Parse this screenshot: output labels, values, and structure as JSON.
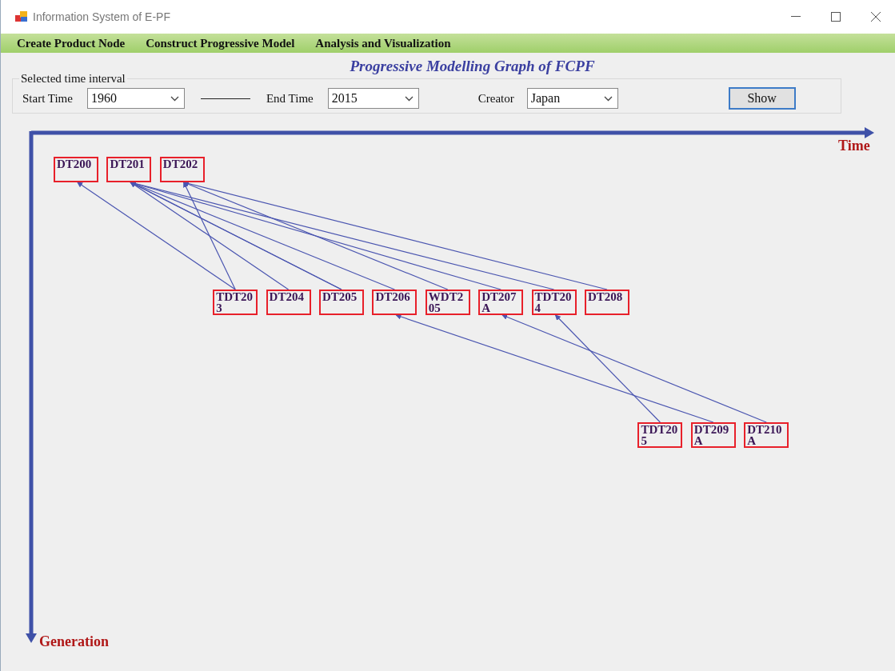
{
  "window": {
    "title": "Information System of E-PF"
  },
  "menu": [
    "Create Product Node",
    "Construct Progressive Model",
    "Analysis and Visualization"
  ],
  "heading": "Progressive Modelling Graph of FCPF",
  "filter": {
    "legend": "Selected time interval",
    "start_label": "Start Time",
    "start_value": "1960",
    "end_label": "End Time",
    "end_value": "2015",
    "creator_label": "Creator",
    "creator_value": "Japan",
    "button": "Show"
  },
  "graph": {
    "x_axis": "Time",
    "y_axis": "Generation",
    "generations": [
      {
        "nodes": [
          "DT200",
          "DT201",
          "DT202"
        ]
      },
      {
        "nodes": [
          "TDT203",
          "DT204",
          "DT205",
          "DT206",
          "WDT205",
          "DT207A",
          "TDT204",
          "DT208"
        ]
      },
      {
        "nodes": [
          "TDT205",
          "DT209A",
          "DT210A"
        ]
      }
    ]
  }
}
